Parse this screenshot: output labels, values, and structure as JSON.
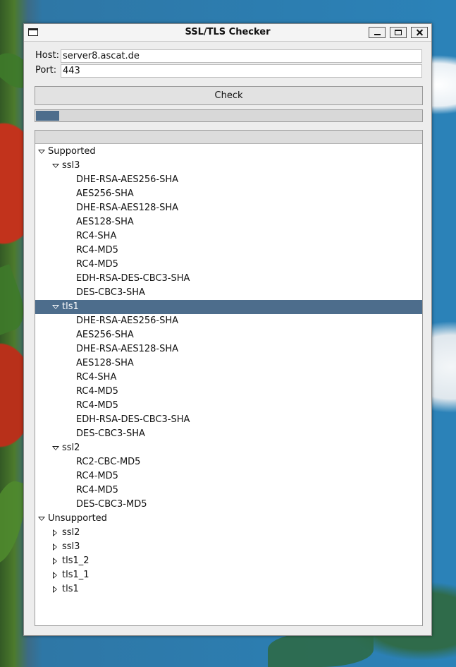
{
  "window": {
    "title": "SSL/TLS Checker"
  },
  "form": {
    "host_label": "Host:",
    "host_value": "server8.ascat.de",
    "port_label": "Port:",
    "port_value": "443",
    "check_label": "Check"
  },
  "progress": {
    "fraction": 0.06,
    "color": "#4d6d8c"
  },
  "tree": {
    "supported": {
      "label": "Supported",
      "ssl3": {
        "label": "ssl3",
        "items": [
          "DHE-RSA-AES256-SHA",
          "AES256-SHA",
          "DHE-RSA-AES128-SHA",
          "AES128-SHA",
          "RC4-SHA",
          "RC4-MD5",
          "RC4-MD5",
          "EDH-RSA-DES-CBC3-SHA",
          "DES-CBC3-SHA"
        ]
      },
      "tls1": {
        "label": "tls1",
        "items": [
          "DHE-RSA-AES256-SHA",
          "AES256-SHA",
          "DHE-RSA-AES128-SHA",
          "AES128-SHA",
          "RC4-SHA",
          "RC4-MD5",
          "RC4-MD5",
          "EDH-RSA-DES-CBC3-SHA",
          "DES-CBC3-SHA"
        ]
      },
      "ssl2": {
        "label": "ssl2",
        "items": [
          "RC2-CBC-MD5",
          "RC4-MD5",
          "RC4-MD5",
          "DES-CBC3-MD5"
        ]
      }
    },
    "unsupported": {
      "label": "Unsupported",
      "items": [
        "ssl2",
        "ssl3",
        "tls1_2",
        "tls1_1",
        "tls1"
      ]
    }
  },
  "colors": {
    "selection": "#4d6d8c",
    "window_bg": "#ededed"
  }
}
